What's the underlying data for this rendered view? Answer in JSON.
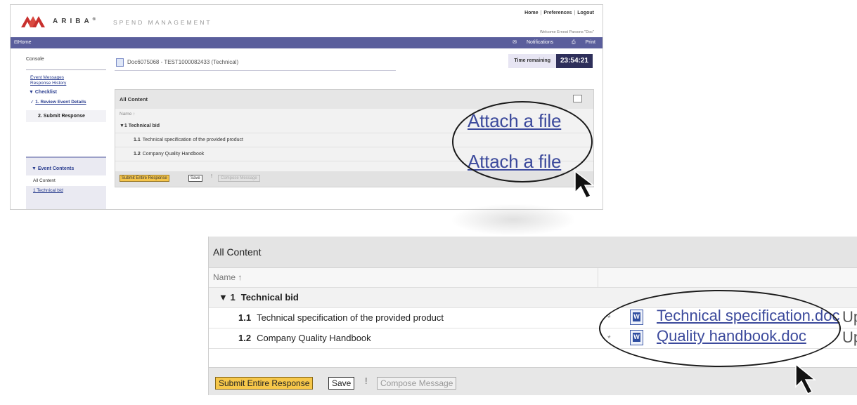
{
  "top_screen": {
    "brand": {
      "logo_text": "ARIBA",
      "trademark": "®",
      "product": "SPEND MANAGEMENT"
    },
    "top_links": [
      "Home",
      "Preferences",
      "Logout"
    ],
    "welcome": "Welcome Ernest Parsons \"Doc\"",
    "navbar": {
      "home": "Home",
      "notifications": "Notifications",
      "print": "Print"
    },
    "left": {
      "console": "Console",
      "links": [
        "Event Messages",
        "Response History"
      ],
      "checklist": "Checklist",
      "step1": "1. Review Event Details",
      "step2": "2. Submit Response",
      "event_contents": "Event Contents",
      "all_content": "All Content",
      "technical_bid": "1 Technical bid"
    },
    "doc_title": "Doc6075068 - TEST1000082433 (Technical)",
    "time_remaining_label": "Time remaining",
    "time_remaining_value": "23:54:21",
    "panel": {
      "title": "All Content",
      "name_header": "Name ↑",
      "section": "▼1  Technical bid",
      "rows": [
        {
          "num": "1.1",
          "label": "Technical specification of the provided product"
        },
        {
          "num": "1.2",
          "label": "Company Quality Handbook"
        }
      ],
      "submit": "Submit Entire Response",
      "save": "Save",
      "separator": "!",
      "compose": "Compose Message"
    },
    "attach_labels": [
      "Attach a file",
      "Attach a file"
    ]
  },
  "zoom": {
    "title": "All Content",
    "name_header": "Name ↑",
    "section_num": "▼ 1",
    "section_label": "Technical bid",
    "rows": [
      {
        "num": "1.1",
        "label": "Technical specification of the provided product",
        "star": "*",
        "file": "Technical specification.doc",
        "trail": "Up"
      },
      {
        "num": "1.2",
        "label": "Company Quality Handbook",
        "star": "*",
        "file": "Quality handbook.doc",
        "trail": "Up"
      }
    ],
    "submit": "Submit Entire Response",
    "save": "Save",
    "separator": "!",
    "compose": "Compose Message"
  }
}
